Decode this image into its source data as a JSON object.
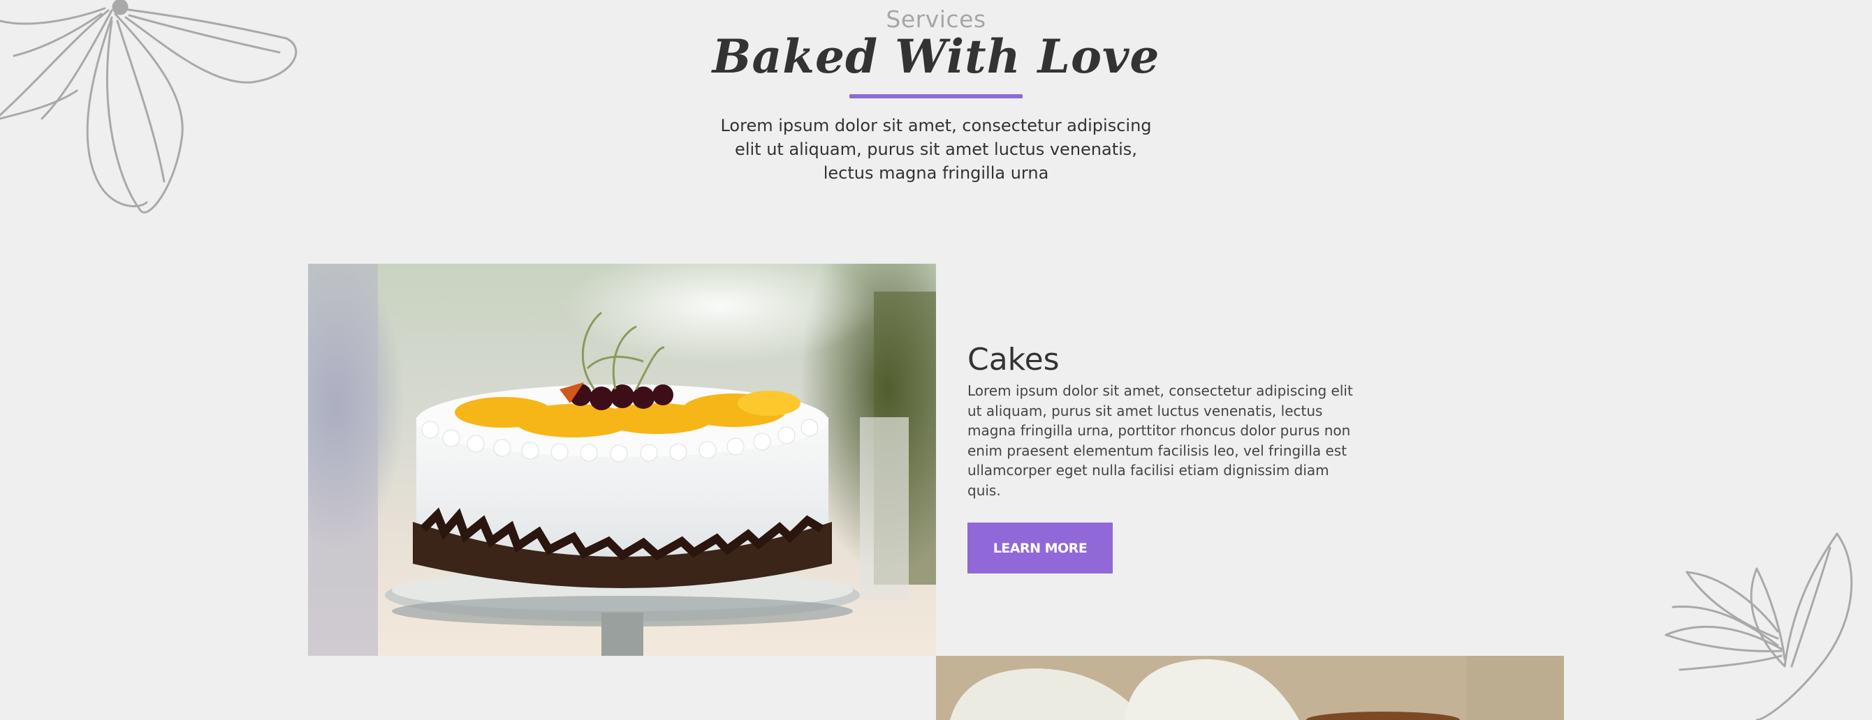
{
  "header": {
    "eyebrow": "Services",
    "title": "Baked With Love",
    "intro": "Lorem ipsum dolor sit amet, consectetur adipiscing elit ut aliquam, purus sit amet luctus venenatis, lectus magna fringilla urna"
  },
  "service": {
    "title": "Cakes",
    "description": "Lorem ipsum dolor sit amet, consectetur adipiscing elit ut aliquam, purus sit amet luctus venenatis, lectus magna fringilla urna, porttitor rhoncus dolor purus non enim praesent elementum facilisis leo, vel fringilla est ullamcorper eget nulla facilisi etiam dignissim diam quis.",
    "button_label": "LEARN MORE"
  },
  "colors": {
    "accent": "#8e6ad8",
    "background": "#efefef",
    "text": "#333333",
    "muted": "#a6a6a6"
  },
  "icons": [
    "flower-decoration-icon",
    "leaf-decoration-icon"
  ]
}
